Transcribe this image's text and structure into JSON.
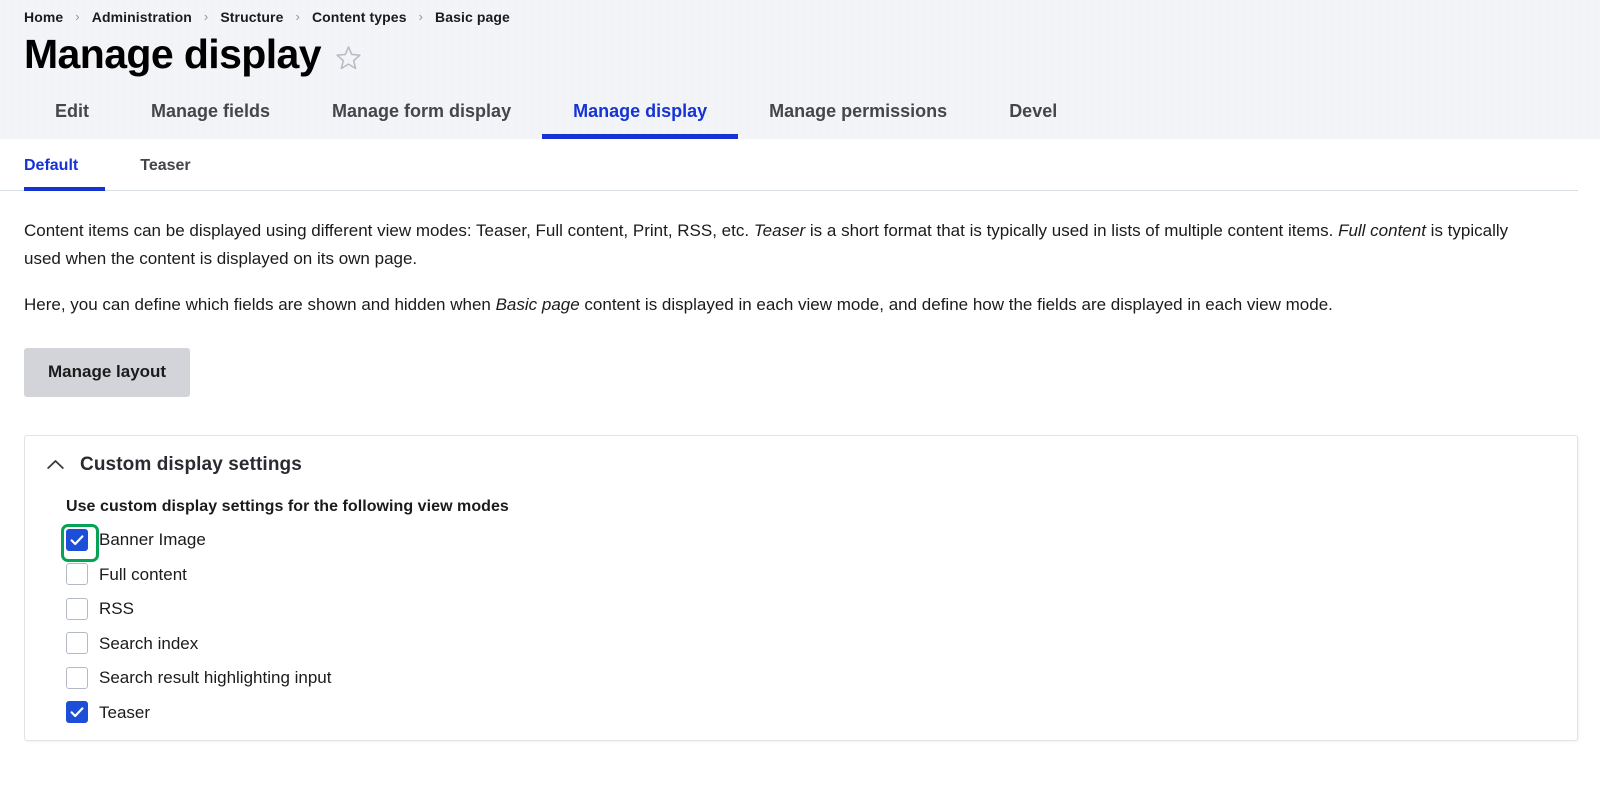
{
  "breadcrumb": {
    "separator": "›",
    "items": [
      {
        "label": "Home"
      },
      {
        "label": "Administration"
      },
      {
        "label": "Structure"
      },
      {
        "label": "Content types"
      },
      {
        "label": "Basic page"
      }
    ]
  },
  "header": {
    "title": "Manage display",
    "star_icon": "star-outline-icon"
  },
  "primary_tabs": [
    {
      "label": "Edit",
      "active": false
    },
    {
      "label": "Manage fields",
      "active": false
    },
    {
      "label": "Manage form display",
      "active": false
    },
    {
      "label": "Manage display",
      "active": true
    },
    {
      "label": "Manage permissions",
      "active": false
    },
    {
      "label": "Devel",
      "active": false
    }
  ],
  "secondary_tabs": [
    {
      "label": "Default",
      "active": true
    },
    {
      "label": "Teaser",
      "active": false
    }
  ],
  "description": {
    "p1_a": "Content items can be displayed using different view modes: Teaser, Full content, Print, RSS, etc. ",
    "p1_em1": "Teaser",
    "p1_b": " is a short format that is typically used in lists of multiple content items. ",
    "p1_em2": "Full content",
    "p1_c": " is typically used when the content is displayed on its own page.",
    "p2_a": "Here, you can define which fields are shown and hidden when ",
    "p2_em1": "Basic page",
    "p2_b": " content is displayed in each view mode, and define how the fields are displayed in each view mode."
  },
  "toolbar": {
    "manage_layout_label": "Manage layout"
  },
  "custom_display_settings": {
    "summary_label": "Custom display settings",
    "collapse_icon": "chevron-up-icon",
    "expanded": true,
    "group_label": "Use custom display settings for the following view modes",
    "view_modes": [
      {
        "label": "Banner Image",
        "checked": true,
        "highlighted": true
      },
      {
        "label": "Full content",
        "checked": false,
        "highlighted": false
      },
      {
        "label": "RSS",
        "checked": false,
        "highlighted": false
      },
      {
        "label": "Search index",
        "checked": false,
        "highlighted": false
      },
      {
        "label": "Search result highlighting input",
        "checked": false,
        "highlighted": false
      },
      {
        "label": "Teaser",
        "checked": true,
        "highlighted": false
      }
    ]
  },
  "colors": {
    "accent_blue": "#1633d4",
    "checkbox_blue": "#1d4ed8",
    "highlight_green": "#06a357",
    "header_bg": "#f3f4f7",
    "button_gray": "#d3d4d9"
  }
}
